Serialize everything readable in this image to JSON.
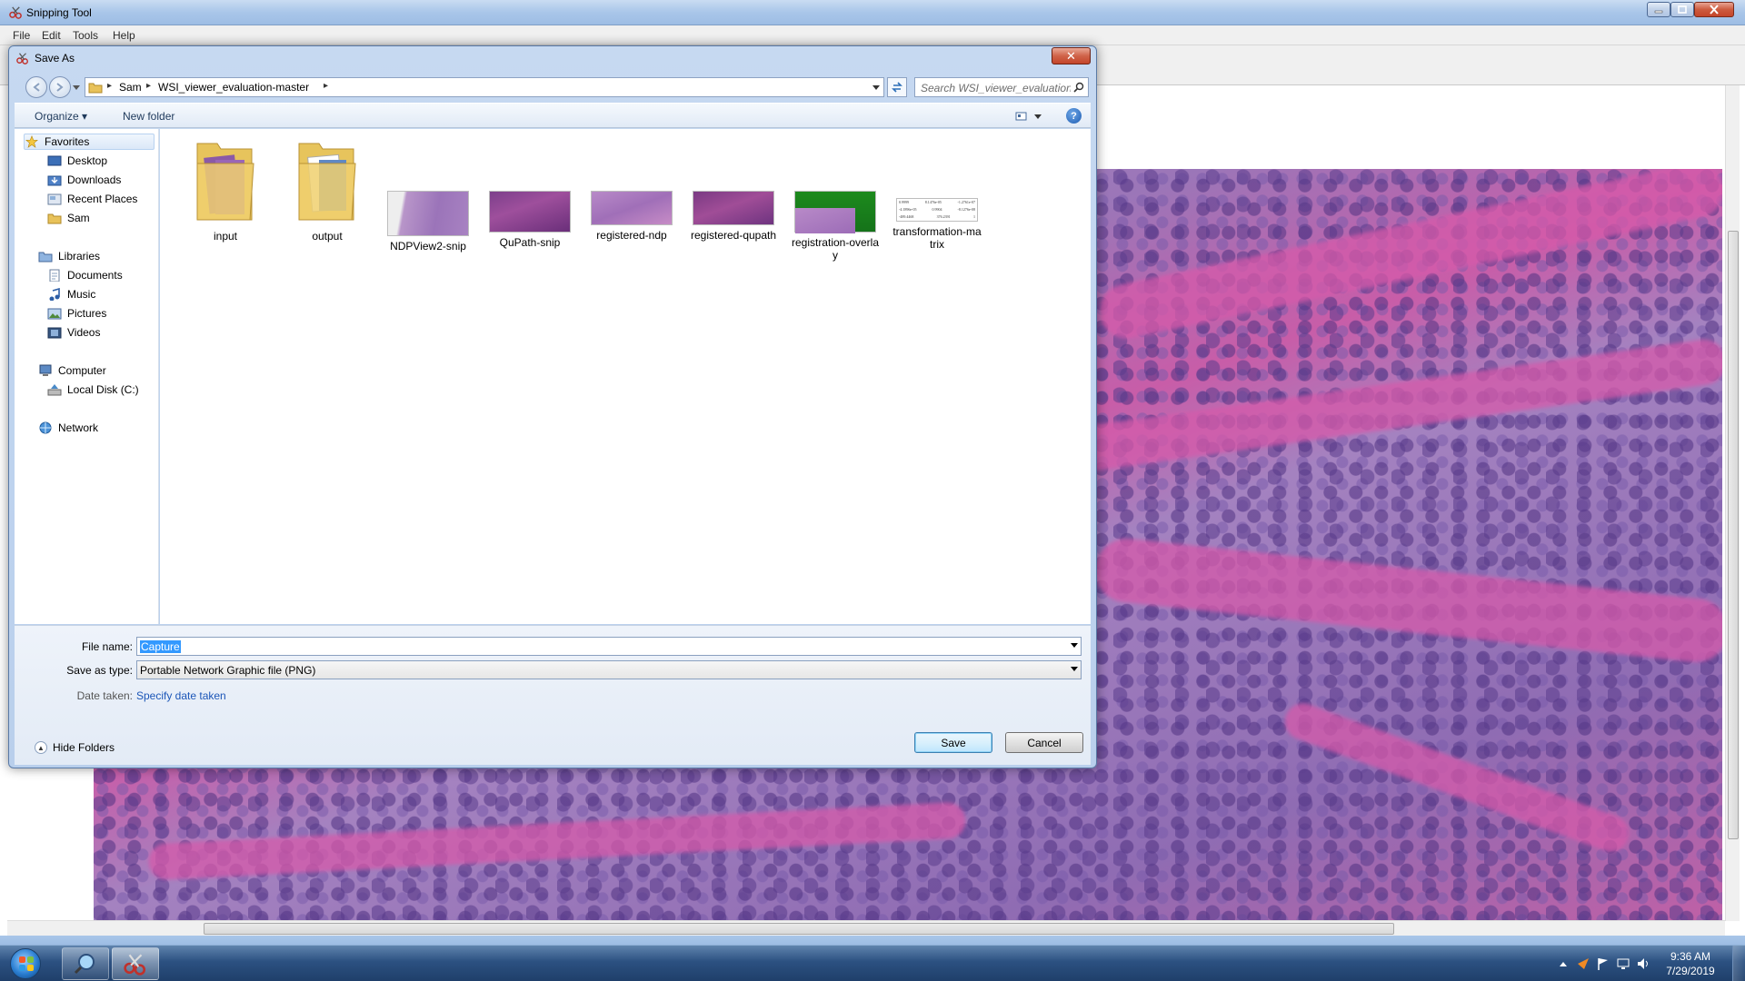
{
  "snipping_tool": {
    "title": "Snipping Tool",
    "menu": [
      "File",
      "Edit",
      "Tools",
      "Help"
    ]
  },
  "dialog": {
    "title": "Save As",
    "address": {
      "crumbs": [
        "Sam",
        "WSI_viewer_evaluation-master"
      ]
    },
    "search_placeholder": "Search WSI_viewer_evaluation...",
    "commands": {
      "organize": "Organize",
      "new_folder": "New folder"
    },
    "nav": {
      "favorites": "Favorites",
      "desktop": "Desktop",
      "downloads": "Downloads",
      "recent_places": "Recent Places",
      "sam": "Sam",
      "libraries": "Libraries",
      "documents": "Documents",
      "music": "Music",
      "pictures": "Pictures",
      "videos": "Videos",
      "computer": "Computer",
      "local_disk": "Local Disk (C:)",
      "network": "Network"
    },
    "files": [
      {
        "name": "input",
        "type": "folder"
      },
      {
        "name": "output",
        "type": "folder"
      },
      {
        "name": "NDPView2-snip",
        "type": "image"
      },
      {
        "name": "QuPath-snip",
        "type": "image"
      },
      {
        "name": "registered-ndp",
        "type": "image"
      },
      {
        "name": "registered-qupath",
        "type": "image"
      },
      {
        "name": "registration-overlay",
        "type": "image"
      },
      {
        "name": "transformation-matrix",
        "type": "image"
      }
    ],
    "matrix_thumb": [
      [
        "0.9999",
        "8.1476e-05",
        "-1.2761e-07"
      ],
      [
        "-4.1896e-05",
        "0.9904",
        "-8.1276e-08"
      ],
      [
        "-489.4468",
        "376.2391",
        "1"
      ]
    ],
    "file_name_label": "File name:",
    "file_name_value": "Capture",
    "save_type_label": "Save as type:",
    "save_type_value": "Portable Network Graphic file (PNG)",
    "date_taken_label": "Date taken:",
    "date_taken_link": "Specify date taken",
    "hide_folders": "Hide Folders",
    "save_button": "Save",
    "cancel_button": "Cancel"
  },
  "taskbar": {
    "time": "9:36 AM",
    "date": "7/29/2019"
  }
}
